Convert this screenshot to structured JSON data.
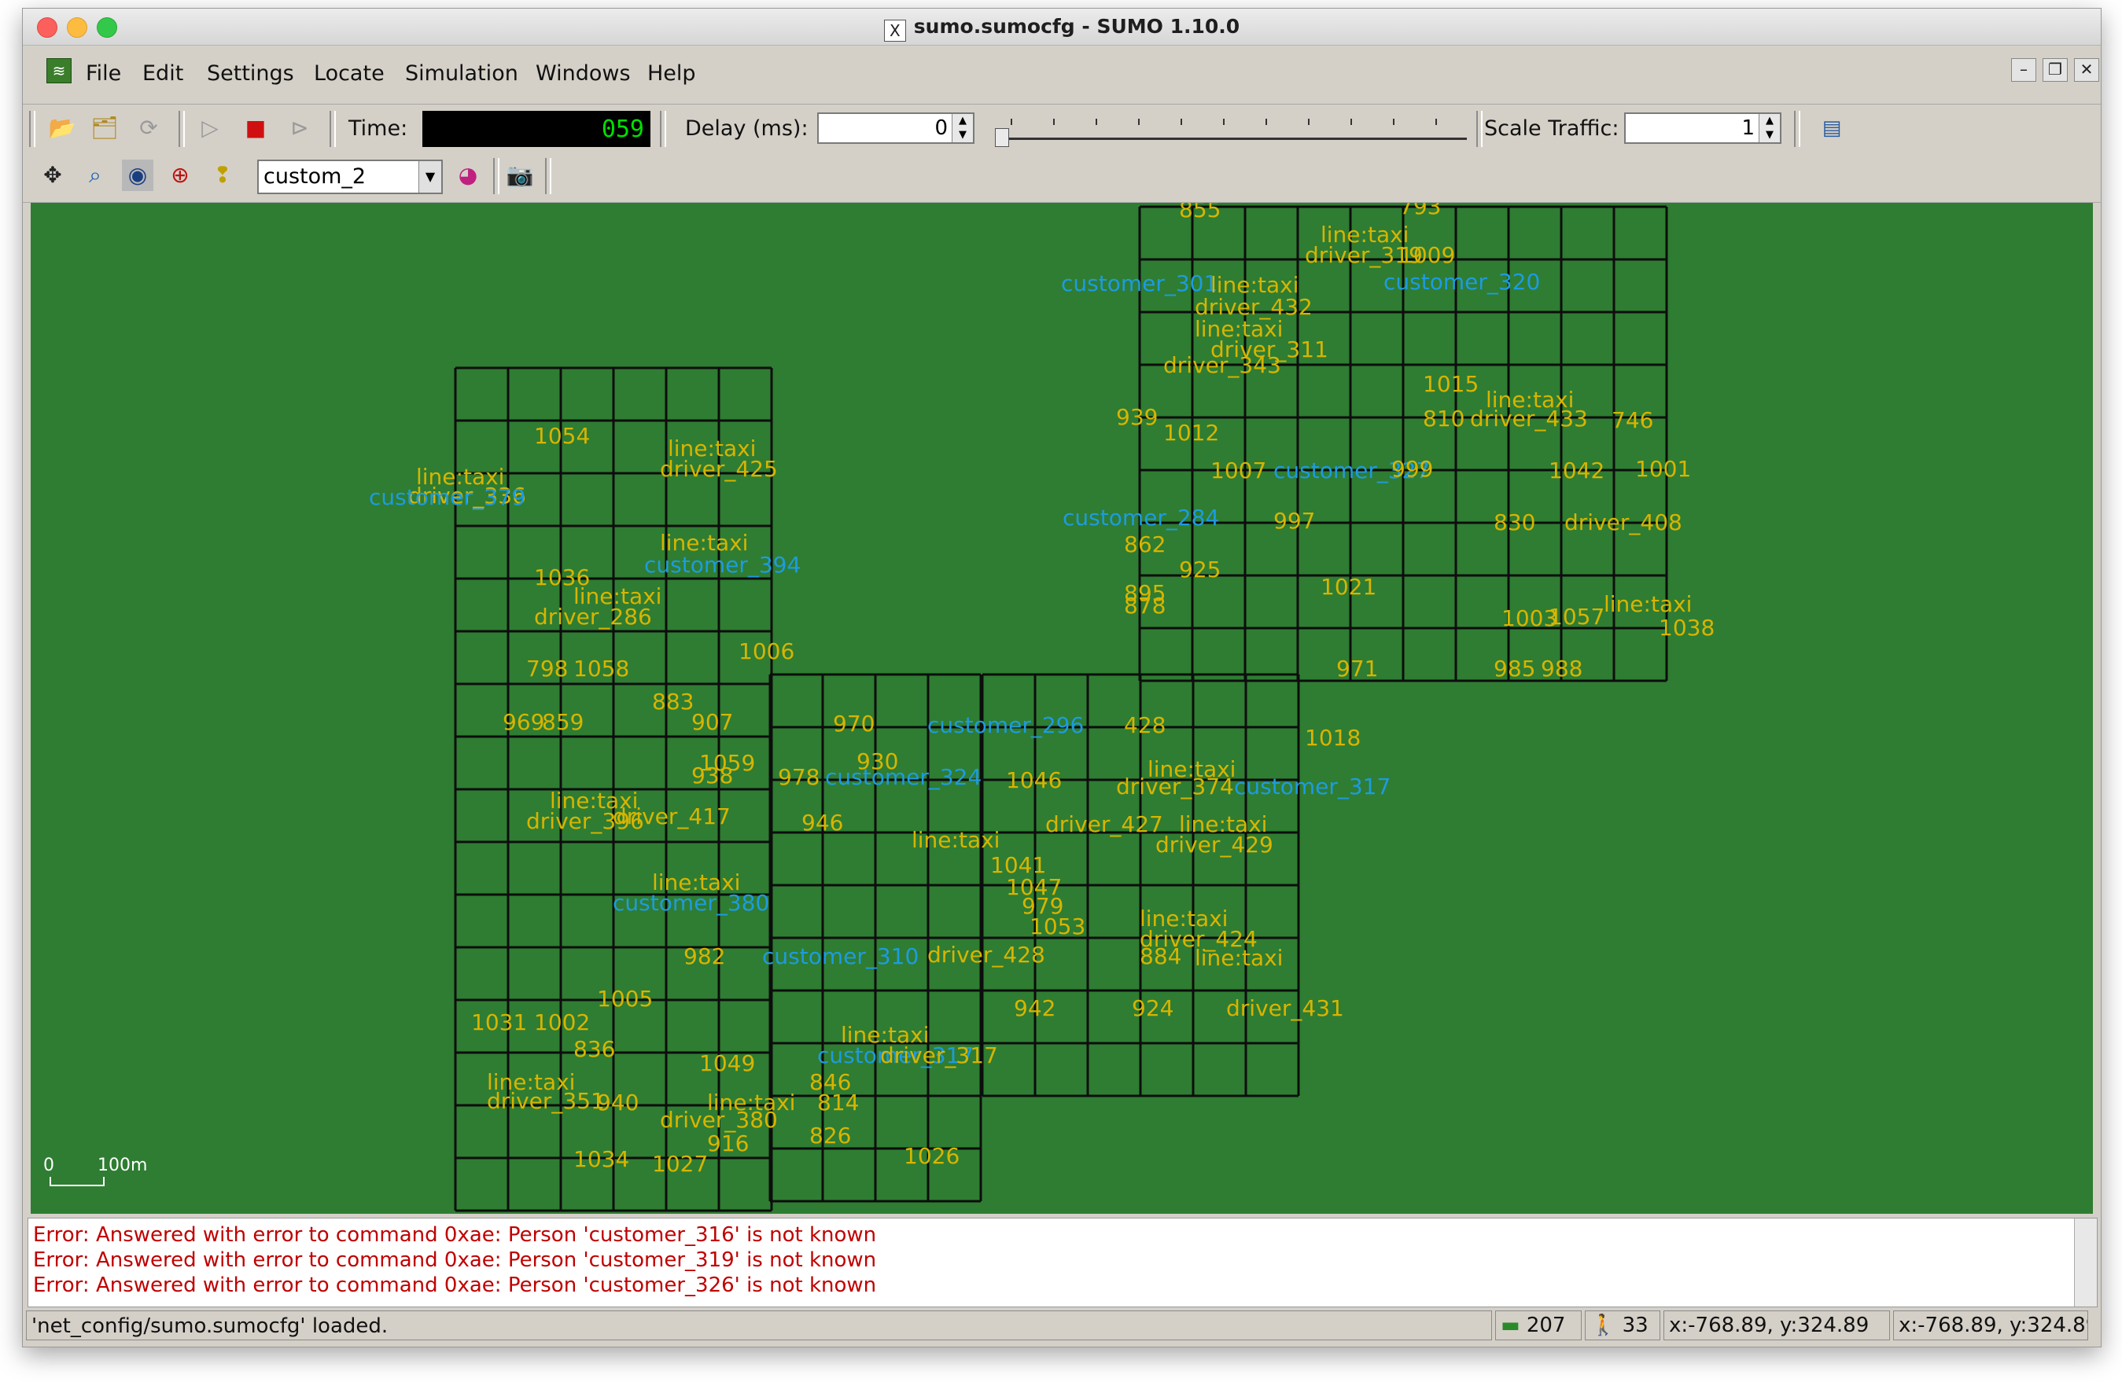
{
  "window": {
    "title": "sumo.sumocfg - SUMO 1.10.0"
  },
  "menu": {
    "items": [
      "File",
      "Edit",
      "Settings",
      "Locate",
      "Simulation",
      "Windows",
      "Help"
    ]
  },
  "toolbar": {
    "time_label": "Time:",
    "time_value": "059",
    "delay_label": "Delay (ms):",
    "delay_value": "0",
    "scale_label": "Scale Traffic:",
    "scale_value": "1"
  },
  "view_toolbar": {
    "scheme": "custom_2"
  },
  "canvas": {
    "background": "#2e7d32",
    "label_color_orange": "#d8b400",
    "label_color_blue": "#1e9be0",
    "scale_bar": {
      "zero": "0",
      "length": "100m"
    },
    "labels": [
      {
        "text": "855",
        "c": "o"
      },
      {
        "text": "793",
        "c": "o"
      },
      {
        "text": "line:taxi",
        "c": "o"
      },
      {
        "text": "driver_319",
        "c": "o"
      },
      {
        "text": "1009",
        "c": "o"
      },
      {
        "text": "customer_301",
        "c": "b"
      },
      {
        "text": "customer_320",
        "c": "b"
      },
      {
        "text": "line:taxi",
        "c": "o"
      },
      {
        "text": "driver_432",
        "c": "o"
      },
      {
        "text": "line:taxi",
        "c": "o"
      },
      {
        "text": "driver_311",
        "c": "o"
      },
      {
        "text": "driver_343",
        "c": "o"
      },
      {
        "text": "1015",
        "c": "o"
      },
      {
        "text": "line:taxi",
        "c": "o"
      },
      {
        "text": "driver_433",
        "c": "o"
      },
      {
        "text": "746",
        "c": "o"
      },
      {
        "text": "939",
        "c": "o"
      },
      {
        "text": "1012",
        "c": "o"
      },
      {
        "text": "810",
        "c": "o"
      },
      {
        "text": "line:taxi",
        "c": "o"
      },
      {
        "text": "driver_425",
        "c": "o"
      },
      {
        "text": "1054",
        "c": "o"
      },
      {
        "text": "line:taxi",
        "c": "o"
      },
      {
        "text": "driver_336",
        "c": "o"
      },
      {
        "text": "customer_379",
        "c": "b"
      },
      {
        "text": "1007",
        "c": "o"
      },
      {
        "text": "customer_327",
        "c": "b"
      },
      {
        "text": "999",
        "c": "o"
      },
      {
        "text": "1042",
        "c": "o"
      },
      {
        "text": "1001",
        "c": "o"
      },
      {
        "text": "customer_284",
        "c": "b"
      },
      {
        "text": "997",
        "c": "o"
      },
      {
        "text": "830",
        "c": "o"
      },
      {
        "text": "driver_408",
        "c": "o"
      },
      {
        "text": "862",
        "c": "o"
      },
      {
        "text": "925",
        "c": "o"
      },
      {
        "text": "line:taxi",
        "c": "o"
      },
      {
        "text": "customer_394",
        "c": "b"
      },
      {
        "text": "1036",
        "c": "o"
      },
      {
        "text": "895",
        "c": "o"
      },
      {
        "text": "878",
        "c": "o"
      },
      {
        "text": "1021",
        "c": "o"
      },
      {
        "text": "line:taxi",
        "c": "o"
      },
      {
        "text": "driver_286",
        "c": "o"
      },
      {
        "text": "1003",
        "c": "o"
      },
      {
        "text": "1057",
        "c": "o"
      },
      {
        "text": "line:taxi",
        "c": "o"
      },
      {
        "text": "1038",
        "c": "o"
      },
      {
        "text": "1006",
        "c": "o"
      },
      {
        "text": "798",
        "c": "o"
      },
      {
        "text": "1058",
        "c": "o"
      },
      {
        "text": "971",
        "c": "o"
      },
      {
        "text": "985",
        "c": "o"
      },
      {
        "text": "988",
        "c": "o"
      },
      {
        "text": "883",
        "c": "o"
      },
      {
        "text": "969",
        "c": "o"
      },
      {
        "text": "859",
        "c": "o"
      },
      {
        "text": "907",
        "c": "o"
      },
      {
        "text": "970",
        "c": "o"
      },
      {
        "text": "customer_296",
        "c": "b"
      },
      {
        "text": "428",
        "c": "o"
      },
      {
        "text": "1018",
        "c": "o"
      },
      {
        "text": "930",
        "c": "o"
      },
      {
        "text": "1059",
        "c": "o"
      },
      {
        "text": "938",
        "c": "o"
      },
      {
        "text": "978",
        "c": "o"
      },
      {
        "text": "customer_324",
        "c": "b"
      },
      {
        "text": "1046",
        "c": "o"
      },
      {
        "text": "line:taxi",
        "c": "o"
      },
      {
        "text": "driver_374",
        "c": "o"
      },
      {
        "text": "customer_317",
        "c": "b"
      },
      {
        "text": "line:taxi",
        "c": "o"
      },
      {
        "text": "driver_396",
        "c": "o"
      },
      {
        "text": "driver_417",
        "c": "o"
      },
      {
        "text": "946",
        "c": "o"
      },
      {
        "text": "line:taxi",
        "c": "o"
      },
      {
        "text": "driver_427",
        "c": "o"
      },
      {
        "text": "line:taxi",
        "c": "o"
      },
      {
        "text": "driver_429",
        "c": "o"
      },
      {
        "text": "1041",
        "c": "o"
      },
      {
        "text": "1047",
        "c": "o"
      },
      {
        "text": "line:taxi",
        "c": "o"
      },
      {
        "text": "customer_380",
        "c": "b"
      },
      {
        "text": "979",
        "c": "o"
      },
      {
        "text": "1053",
        "c": "o"
      },
      {
        "text": "line:taxi",
        "c": "o"
      },
      {
        "text": "driver_424",
        "c": "o"
      },
      {
        "text": "982",
        "c": "o"
      },
      {
        "text": "customer_310",
        "c": "b"
      },
      {
        "text": "driver_428",
        "c": "o"
      },
      {
        "text": "884",
        "c": "o"
      },
      {
        "text": "line:taxi",
        "c": "o"
      },
      {
        "text": "942",
        "c": "o"
      },
      {
        "text": "924",
        "c": "o"
      },
      {
        "text": "driver_431",
        "c": "o"
      },
      {
        "text": "1005",
        "c": "o"
      },
      {
        "text": "1031",
        "c": "o"
      },
      {
        "text": "1002",
        "c": "o"
      },
      {
        "text": "line:taxi",
        "c": "o"
      },
      {
        "text": "customer_317",
        "c": "b"
      },
      {
        "text": "driver_317",
        "c": "o"
      },
      {
        "text": "836",
        "c": "o"
      },
      {
        "text": "1049",
        "c": "o"
      },
      {
        "text": "line:taxi",
        "c": "o"
      },
      {
        "text": "driver_351",
        "c": "o"
      },
      {
        "text": "940",
        "c": "o"
      },
      {
        "text": "line:taxi",
        "c": "o"
      },
      {
        "text": "driver_380",
        "c": "o"
      },
      {
        "text": "846",
        "c": "o"
      },
      {
        "text": "814",
        "c": "o"
      },
      {
        "text": "826",
        "c": "o"
      },
      {
        "text": "916",
        "c": "o"
      },
      {
        "text": "1034",
        "c": "o"
      },
      {
        "text": "1027",
        "c": "o"
      },
      {
        "text": "1026",
        "c": "o"
      }
    ]
  },
  "messages": [
    "Error: Answered with error to command 0xae: Person 'customer_316' is not known",
    "Error: Answered with error to command 0xae: Person 'customer_319' is not known",
    "Error: Answered with error to command 0xae: Person 'customer_326' is not known"
  ],
  "statusbar": {
    "message": "'net_config/sumo.sumocfg' loaded.",
    "vehicle_count": "207",
    "person_count": "33",
    "coords_net": "x:-768.89, y:324.89",
    "coords_geo": "x:-768.89, y:324.89"
  }
}
